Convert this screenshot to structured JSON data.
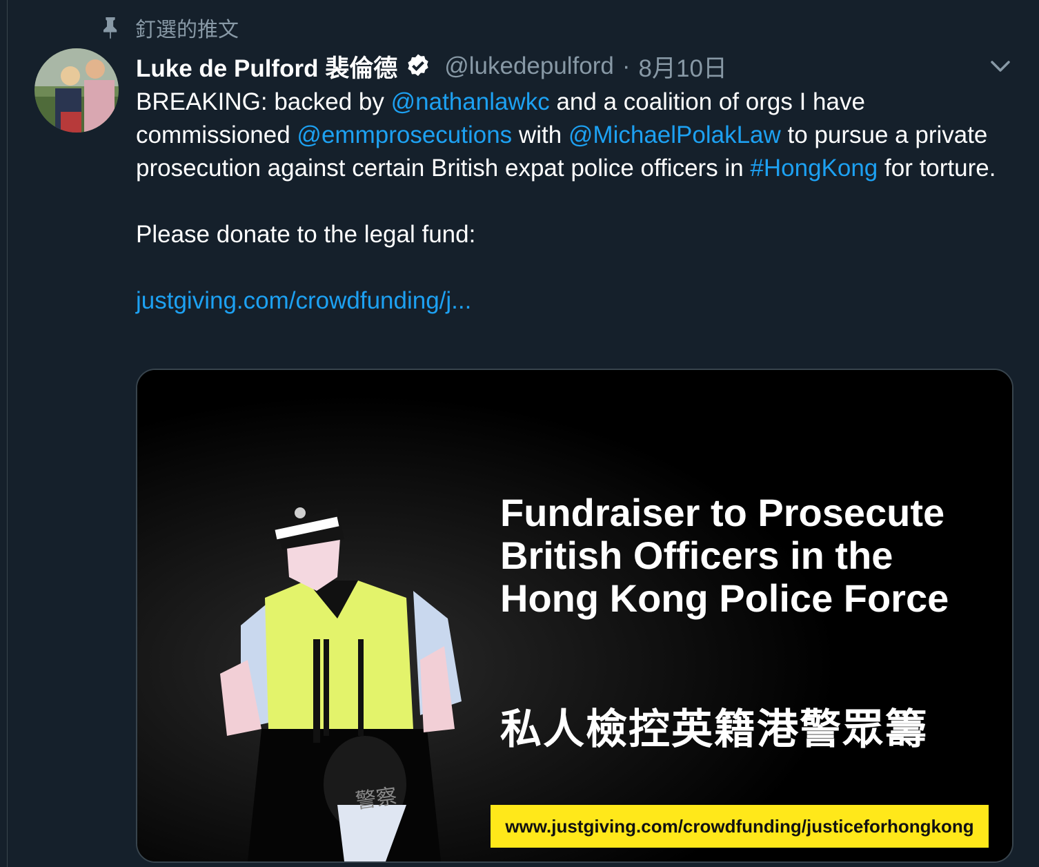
{
  "pinned": {
    "label": "釘選的推文",
    "icon": "pin-icon"
  },
  "tweet": {
    "display_name": "Luke de Pulford 裴倫德",
    "verified": true,
    "handle": "@lukedepulford",
    "separator": "·",
    "date": "8月10日",
    "text": {
      "line1_a": "BREAKING: backed by ",
      "mention_1": "@nathanlawkc",
      "line1_b": " and a coalition of orgs I have commissioned ",
      "mention_2": "@emmprosecutions",
      "line1_c": " with ",
      "mention_3": "@MichaelPolakLaw",
      "line1_d": " to pursue a private prosecution against certain British expat police officers in ",
      "hashtag": "#HongKong",
      "line1_e": " for torture.",
      "paragraph_2": "Please donate to the legal fund:",
      "link": "justgiving.com/crowdfunding/j..."
    },
    "media": {
      "headline": "Fundraiser to Prosecute British Officers in the Hong Kong Police Force",
      "chinese_title": "私人檢控英籍港警眾籌",
      "cap_text": "警察",
      "url_banner": "www.justgiving.com/crowdfunding/justiceforhongkong",
      "banner_color": "#ffe81a"
    }
  },
  "colors": {
    "background": "#15202b",
    "link": "#1da1f2",
    "muted": "#8899a6",
    "border": "#38444d"
  }
}
